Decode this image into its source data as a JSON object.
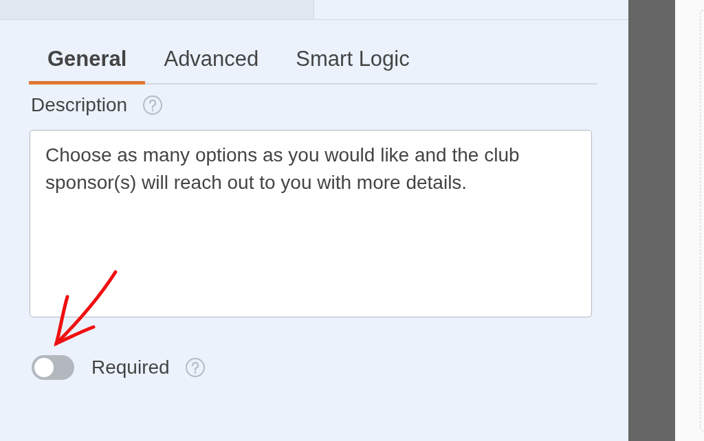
{
  "tabs": [
    {
      "label": "General",
      "selected": true
    },
    {
      "label": "Advanced",
      "selected": false
    },
    {
      "label": "Smart Logic",
      "selected": false
    }
  ],
  "description": {
    "label": "Description",
    "value": "Choose as many options as you would like and the club sponsor(s) will reach out to you with more details."
  },
  "required": {
    "label": "Required",
    "on": false
  }
}
